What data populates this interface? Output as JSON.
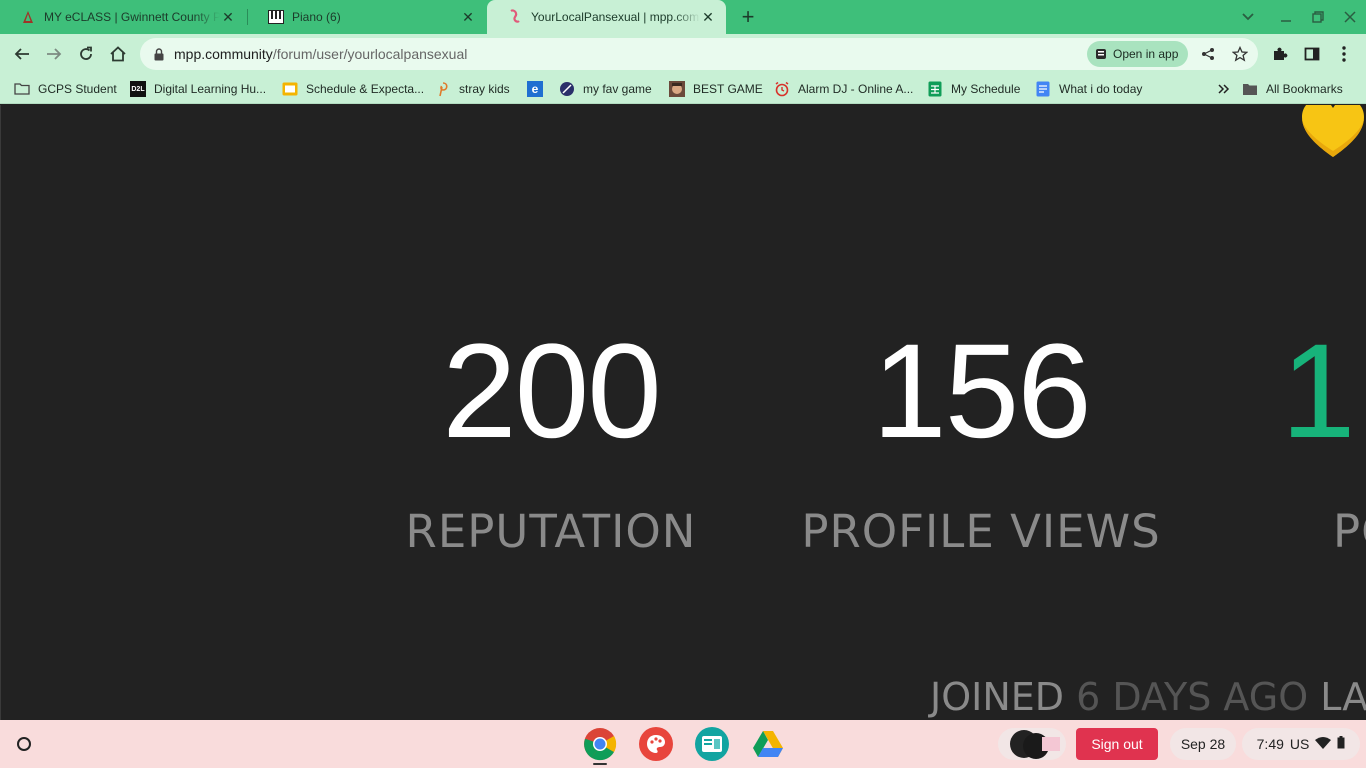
{
  "browser": {
    "tabs": [
      {
        "title": "MY eCLASS | Gwinnett County P",
        "active": false
      },
      {
        "title": "Piano (6)",
        "active": false
      },
      {
        "title": "YourLocalPansexual | mpp.com",
        "active": true
      }
    ],
    "url_host": "mpp.community",
    "url_path": "/forum/user/yourlocalpansexual",
    "open_in_app_label": "Open in app",
    "bookmarks": [
      "GCPS Student",
      "Digital Learning Hu...",
      "Schedule & Expecta...",
      "stray kids",
      "",
      "my fav game",
      "BEST GAME",
      "Alarm DJ - Online A...",
      "My Schedule",
      "What i do today"
    ],
    "all_bookmarks_label": "All Bookmarks"
  },
  "profile": {
    "reputation_value": "200",
    "reputation_label": "REPUTATION",
    "views_value": "156",
    "views_label": "PROFILE VIEWS",
    "posts_value_partial": "1",
    "posts_label_partial": "PO",
    "joined_prefix": "JOINED",
    "joined_value": "6 DAYS AGO",
    "joined_suffix_partial": "LA",
    "accent_color": "#17b37a"
  },
  "shelf": {
    "sign_out_label": "Sign out",
    "date": "Sep 28",
    "time": "7:49",
    "locale": "US"
  },
  "icons": {
    "heart": "yellow-heart-emoji"
  }
}
